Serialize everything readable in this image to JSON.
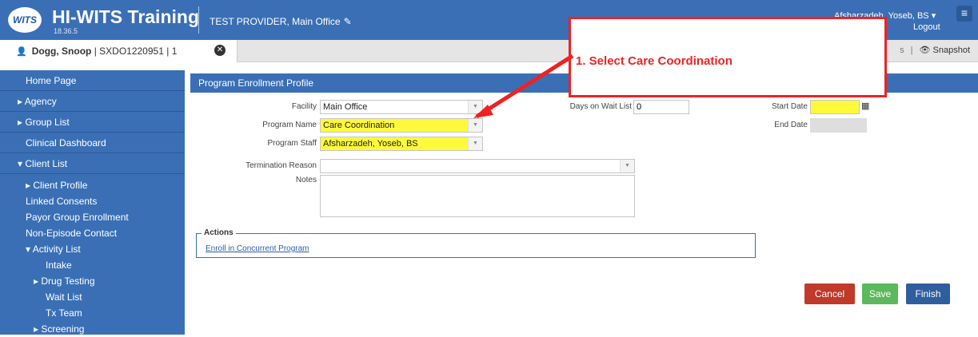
{
  "header": {
    "logo_text": "WITS",
    "app_title": "HI-WITS Training",
    "version": "18.36.5",
    "provider": "TEST PROVIDER, Main Office",
    "user_name": "Afsharzadeh, Yoseb, BS",
    "logout_label": "Logout"
  },
  "client_bar": {
    "client_name": "Dogg, Snoop",
    "client_id": "SXDO1220951",
    "client_suffix": "1",
    "links_fragment": "s",
    "snapshot_label": "Snapshot"
  },
  "sidebar": {
    "home": "Home Page",
    "agency": "Agency",
    "group_list": "Group List",
    "clinical_dashboard": "Clinical Dashboard",
    "client_list": "Client List",
    "client_profile": "Client Profile",
    "linked_consents": "Linked Consents",
    "payor_group_enrollment": "Payor Group Enrollment",
    "non_episode_contact": "Non-Episode Contact",
    "activity_list": "Activity List",
    "intake": "Intake",
    "drug_testing": "Drug Testing",
    "wait_list": "Wait List",
    "tx_team": "Tx Team",
    "screening": "Screening"
  },
  "form": {
    "title": "Program Enrollment Profile",
    "facility_label": "Facility",
    "facility_value": "Main Office",
    "program_name_label": "Program Name",
    "program_name_value": "Care Coordination",
    "program_staff_label": "Program Staff",
    "program_staff_value": "Afsharzadeh, Yoseb, BS",
    "termination_reason_label": "Termination Reason",
    "termination_reason_value": "",
    "notes_label": "Notes",
    "days_wait_label": "Days on Wait List",
    "days_wait_value": "0",
    "start_date_label": "Start Date",
    "end_date_label": "End Date"
  },
  "actions": {
    "legend": "Actions",
    "enroll_link": "Enroll in Concurrent Program"
  },
  "buttons": {
    "cancel": "Cancel",
    "save": "Save",
    "finish": "Finish"
  },
  "callout": {
    "text": "1. Select Care Coordination"
  }
}
